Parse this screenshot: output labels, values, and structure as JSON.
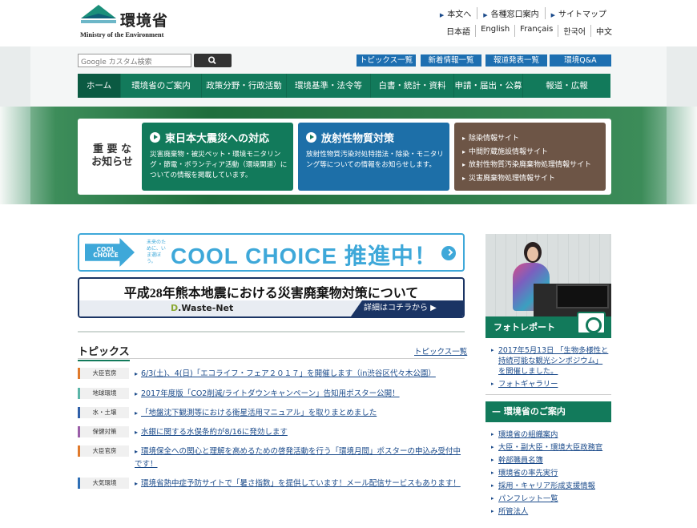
{
  "header": {
    "logo_jp": "環境省",
    "logo_en": "Ministry of the Environment",
    "top_links": [
      "本文へ",
      "各種窓口案内",
      "サイトマップ"
    ],
    "languages": [
      "日本語",
      "English",
      "Français",
      "한국어",
      "中文"
    ]
  },
  "search": {
    "placeholder": "Google カスタム検索"
  },
  "quick_buttons": [
    "トピックス一覧",
    "新着情報一覧",
    "報道発表一覧",
    "環境Q&A"
  ],
  "menu": [
    "ホーム",
    "環境省のご案内",
    "政策分野・行政活動",
    "環境基準・法令等",
    "白書・統計・資料",
    "申請・届出・公募",
    "報道・広報"
  ],
  "notice": {
    "label": "重 要 な お知らせ",
    "card1": {
      "title": "東日本大震災への対応",
      "desc": "災害廃棄物・被災ペット・環境モニタリング・節電・ボランティア活動（環境関連）についての情報を掲載しています。"
    },
    "card2": {
      "title": "放射性物質対策",
      "desc": "放射性物質汚染対処特措法・除染・モニタリング等についての情報をお知らせします。"
    },
    "card3": [
      "除染情報サイト",
      "中間貯蔵施設情報サイト",
      "放射性物質汚染廃棄物処理情報サイト",
      "災害廃棄物処理情報サイト"
    ]
  },
  "banners": {
    "cool_choice_logo": "COOL CHOICE",
    "cool_choice_small": "未来のために、いま選ぼう。",
    "cool_choice_text": "COOL CHOICE 推進中！",
    "kumamoto_title": "平成28年熊本地震における災害廃棄物対策について",
    "waste_net_d": "D",
    "waste_net_rest": ".Waste-Net",
    "kumamoto_detail": "詳細はコチラから ▶"
  },
  "topics": {
    "title": "トピックス",
    "all_link": "トピックス一覧",
    "items": [
      {
        "tag": "大臣官房",
        "color": "#e07a2c",
        "text": "6/3(土)、4(日)「エコライフ・フェア２０１７」を開催します（in渋谷区代々木公園）"
      },
      {
        "tag": "地球環境",
        "color": "#5bb5a8",
        "text": "2017年度版「CO2削減/ライトダウンキャンペーン」告知用ポスター公開！"
      },
      {
        "tag": "水・土壌",
        "color": "#2f5fa8",
        "text": "「地盤沈下観測等における衛星活用マニュアル」を取りまとめました"
      },
      {
        "tag": "保健対策",
        "color": "#9a5ea8",
        "text": "水銀に関する水俣条約が8/16に発効します"
      },
      {
        "tag": "大臣官房",
        "color": "#e07a2c",
        "text": "環境保全への関心と理解を高めるための啓発活動を行う「環境月間」ポスターの申込み受付中です！"
      },
      {
        "tag": "大気環境",
        "color": "#2f6fb5",
        "text": "環境省熱中症予防サイトで「暑さ指数」を提供しています！メール配信サービスもあります！"
      }
    ]
  },
  "sidebar": {
    "photo_report": "フォトレポート",
    "photo_links": [
      "2017年5月13日 「生物多様性と持続可能な観光シンポジウム」を開催しました。",
      "フォトギャラリー"
    ],
    "about_title": "環境省のご案内",
    "about_links": [
      "環境省の組織案内",
      "大臣・副大臣・環境大臣政務官",
      "幹部職員名簿",
      "環境省の率先実行",
      "採用・キャリア形成支援情報",
      "パンフレット一覧",
      "所管法人"
    ]
  }
}
